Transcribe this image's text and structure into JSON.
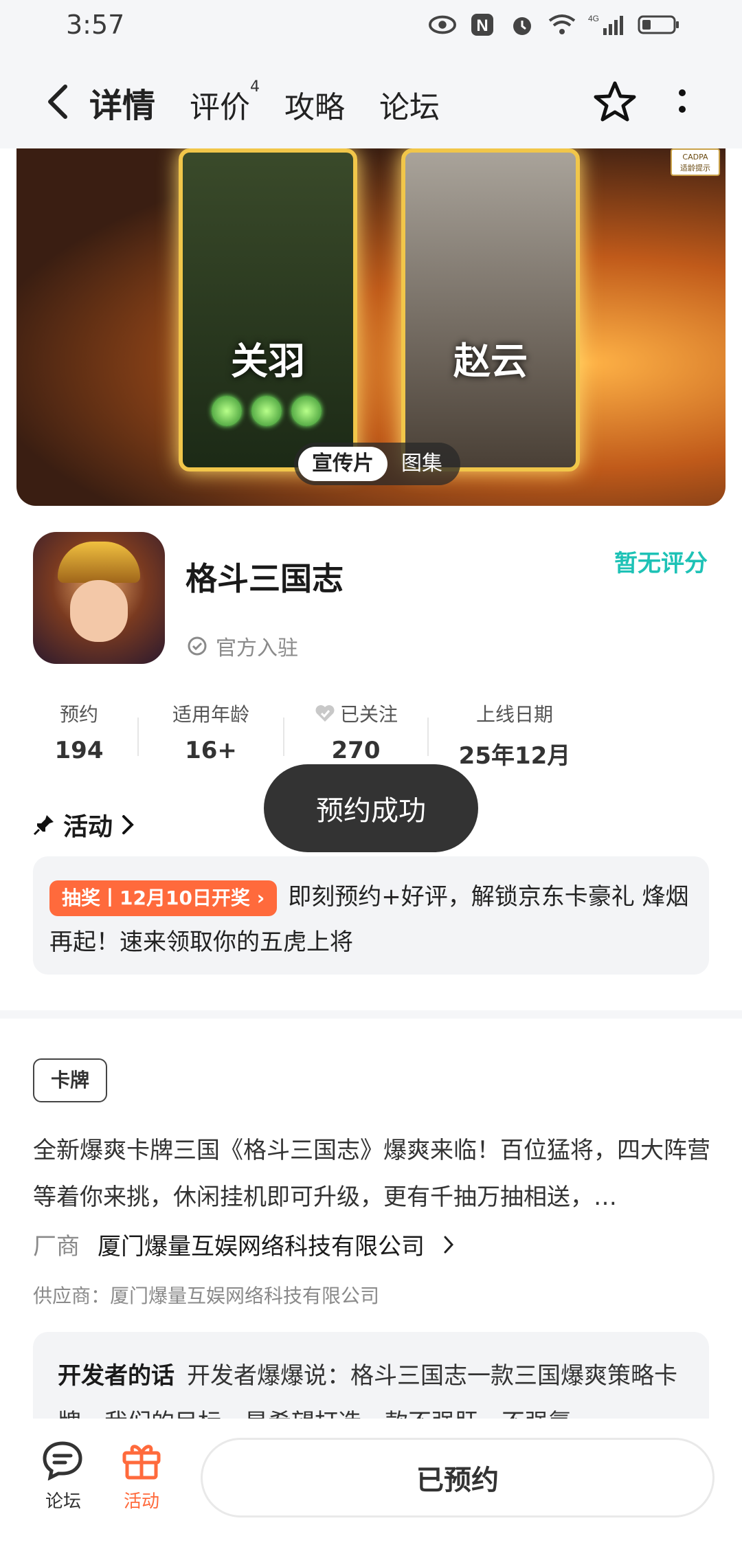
{
  "status_bar": {
    "time": "3:57",
    "network_label": "4G"
  },
  "nav": {
    "tabs": [
      {
        "label": "详情",
        "active": true
      },
      {
        "label": "评价",
        "badge": "4"
      },
      {
        "label": "攻略"
      },
      {
        "label": "论坛"
      }
    ]
  },
  "banner": {
    "left_card_name": "关羽",
    "right_card_name": "赵云",
    "age_badge_top": "CADPA",
    "age_badge_bottom": "适龄提示",
    "media_options": [
      "宣传片",
      "图集"
    ]
  },
  "app": {
    "name": "格斗三国志",
    "official_label": "官方入驻",
    "rating_label": "暂无评分"
  },
  "stats": [
    {
      "label": "预约",
      "value": "194"
    },
    {
      "label": "适用年龄",
      "value": "16+"
    },
    {
      "label": "已关注",
      "value": "270"
    },
    {
      "label": "上线日期",
      "value": "25年12月"
    }
  ],
  "toast": "预约成功",
  "activity": {
    "title": "活动",
    "tag": "抽奖丨12月10日开奖",
    "text": "即刻预约+好评，解锁京东卡豪礼 烽烟再起！速来领取你的五虎上将"
  },
  "category_tag": "卡牌",
  "description": "全新爆爽卡牌三国《格斗三国志》爆爽来临！百位猛将，四大阵营等着你来挑，休闲挂机即可升级，更有千抽万抽相送，…",
  "vendor": {
    "key": "厂商",
    "value": "厦门爆量互娱网络科技有限公司"
  },
  "supplier": "供应商：厦门爆量互娱网络科技有限公司",
  "developer": {
    "label": "开发者的话",
    "text": "开发者爆爆说：格斗三国志一款三国爆爽策略卡牌，我们的目标，是希望打造一款不强肝，不强氪"
  },
  "bottom_bar": {
    "forum_label": "论坛",
    "activity_label": "活动",
    "reserve_button": "已预约"
  },
  "colors": {
    "accent": "#18c6c0",
    "rating": "#1ec2b6",
    "orange": "#ff6a3c",
    "toast_bg": "#333333"
  }
}
